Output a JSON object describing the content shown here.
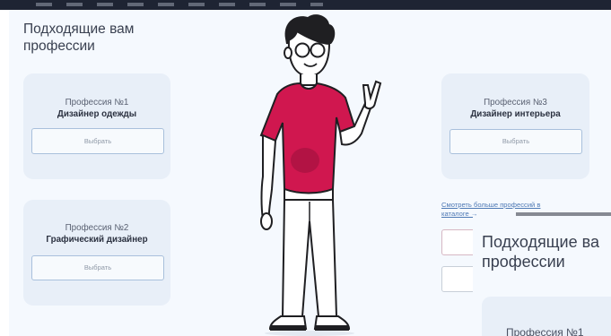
{
  "page": {
    "title": "Подходящие вам профессии"
  },
  "cards": [
    {
      "number": "Профессия №1",
      "name": "Дизайнер одежды",
      "button": "Выбрать"
    },
    {
      "number": "Профессия №2",
      "name": "Графический дизайнер",
      "button": "Выбрать"
    },
    {
      "number": "Профессия №3",
      "name": "Дизайнер интерьера",
      "button": "Выбрать"
    }
  ],
  "catalog_link": {
    "line1": "Смотреть больше профессий в",
    "line2": "каталоге →"
  },
  "overlay": {
    "title": "Подходящие ва профессии",
    "card_number": "Профессия №1"
  },
  "illustration": {
    "icon": "person-victory-icon",
    "shirt_color": "#d0174f",
    "pants_color": "#ffffff"
  },
  "colors": {
    "page_bg": "#f5f9fe",
    "card_bg": "#e8eff8",
    "button_border": "#a9c0dc",
    "link": "#4e79b4"
  }
}
